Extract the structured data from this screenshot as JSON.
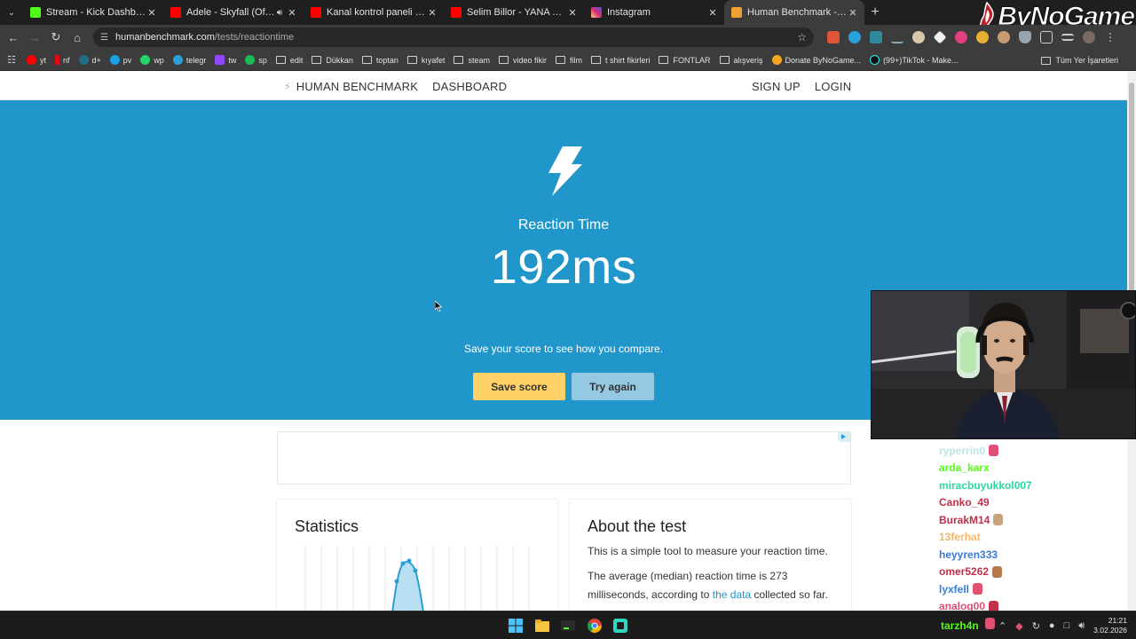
{
  "browser": {
    "tabs": [
      {
        "label": "Stream - Kick Dashboard",
        "fav_color": "#53fc18",
        "active": false
      },
      {
        "label": "Adele - Skyfall (Official Lyric",
        "fav_color": "#ff0000",
        "active": false,
        "audio": true
      },
      {
        "label": "Kanal kontrol paneli - YouTube",
        "fav_color": "#ff0000",
        "active": false
      },
      {
        "label": "Selim Billor - YANA YANA ft. Es",
        "fav_color": "#ff0000",
        "active": false
      },
      {
        "label": "Instagram",
        "fav_color": "#d62976",
        "active": false
      },
      {
        "label": "Human Benchmark - Reaction T",
        "fav_color": "#f0a030",
        "active": true
      }
    ],
    "url_host": "humanbenchmark.com",
    "url_path": "/tests/reactiontime",
    "bookmarks": [
      {
        "label": "yt",
        "color": "#ff0000",
        "type": "site"
      },
      {
        "label": "nf",
        "color": "#e50914",
        "type": "site"
      },
      {
        "label": "d+",
        "color": "#1f6f8b",
        "type": "site"
      },
      {
        "label": "pv",
        "color": "#1aa0e6",
        "type": "site"
      },
      {
        "label": "wp",
        "color": "#25d366",
        "type": "site"
      },
      {
        "label": "telegr",
        "color": "#2aa1da",
        "type": "site"
      },
      {
        "label": "tw",
        "color": "#9146ff",
        "type": "site"
      },
      {
        "label": "sp",
        "color": "#1db954",
        "type": "site"
      },
      {
        "label": "edit",
        "type": "folder"
      },
      {
        "label": "Dükkan",
        "type": "folder"
      },
      {
        "label": "toptan",
        "type": "folder"
      },
      {
        "label": "kıyafet",
        "type": "folder"
      },
      {
        "label": "steam",
        "type": "folder"
      },
      {
        "label": "video fikir",
        "type": "folder"
      },
      {
        "label": "film",
        "type": "folder"
      },
      {
        "label": "t shirt fikirleri",
        "type": "folder"
      },
      {
        "label": "FONTLAR",
        "type": "folder"
      },
      {
        "label": "alışveriş",
        "type": "folder"
      },
      {
        "label": "Donate ByNoGame...",
        "color": "#f5a623",
        "type": "site"
      },
      {
        "label": "(99+)TikTok - Make...",
        "color": "#111111",
        "type": "site"
      }
    ],
    "bookmarks_all": "Tüm Yer İşaretleri",
    "brand_overlay": "ByNoGame"
  },
  "site": {
    "nav_brand": "HUMAN BENCHMARK",
    "nav_dashboard": "DASHBOARD",
    "nav_signup": "SIGN UP",
    "nav_login": "LOGIN",
    "hero_title": "Reaction Time",
    "score": "192ms",
    "subtitle": "Save your score to see how you compare.",
    "save_label": "Save score",
    "try_label": "Try again",
    "hero_color": "#2196cb",
    "stats_title": "Statistics",
    "about_title": "About the test",
    "about_p1": "This is a simple tool to measure your reaction time.",
    "about_p2_pre": "The average (median) reaction time is 273 milliseconds, according to",
    "about_p2_link": "the data",
    "about_p2_post": "collected so far."
  },
  "chat": [
    {
      "user": "ryperrin0",
      "color": "#8fd1d8",
      "emote": "#e05070"
    },
    {
      "user": "arda_karx",
      "color": "#53fc18",
      "msg": "..."
    },
    {
      "user": "miracbuyukkol007",
      "color": "#2bd9a0",
      "msg": ""
    },
    {
      "user": "Canko_49",
      "color": "#c0304a",
      "msg": ""
    },
    {
      "user": "BurakM14",
      "color": "#c0304a",
      "emote": "#c9a27a"
    },
    {
      "user": "13ferhat",
      "color": "#f2a541",
      "msg": ""
    },
    {
      "user": "heyyren333",
      "color": "#3a7bd5",
      "msg": ""
    },
    {
      "user": "omer5262",
      "color": "#c0304a",
      "emote": "#b57a4a"
    },
    {
      "user": "lyxfell",
      "color": "#3a7bd5",
      "emote": "#e05070"
    },
    {
      "user": "analog00",
      "color": "#e05070",
      "emote": "#c0304a"
    }
  ],
  "streamer_name": "tarzh4n",
  "taskbar": {
    "time": "21:21",
    "date": "3.02.2026"
  }
}
